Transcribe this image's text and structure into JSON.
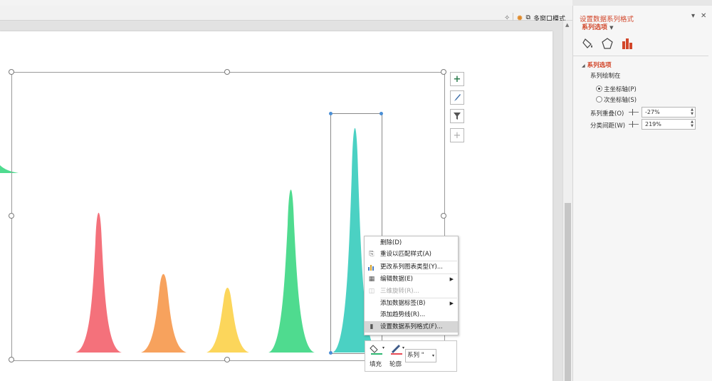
{
  "toolbar": {
    "multi_window_label": "多窗口模式"
  },
  "chart": {
    "colors": {
      "red": "#f4717b",
      "orange": "#f7a25d",
      "yellow": "#fcd65b",
      "green": "#4fdb8f",
      "teal": "#4bd1c3"
    },
    "buttons": [
      "add-element",
      "chart-style",
      "chart-filter",
      "crosshair"
    ]
  },
  "context_menu": {
    "items": [
      {
        "label": "删除(D)",
        "icon": "delete-icon",
        "enabled": true
      },
      {
        "label": "重设以匹配样式(A)",
        "icon": "reset-style-icon",
        "enabled": true
      },
      {
        "label": "更改系列图表类型(Y)...",
        "icon": "bar-chart-icon",
        "enabled": true
      },
      {
        "label": "编辑数据(E)",
        "icon": "edit-data-icon",
        "enabled": true,
        "submenu": true
      },
      {
        "label": "三维旋转(R)...",
        "icon": "rotate-3d-icon",
        "enabled": false
      },
      {
        "label": "添加数据标签(B)",
        "icon": "",
        "enabled": true,
        "submenu": true
      },
      {
        "label": "添加趋势线(R)...",
        "icon": "",
        "enabled": true
      },
      {
        "label": "设置数据系列格式(F)...",
        "icon": "format-series-icon",
        "enabled": true,
        "active": true
      }
    ]
  },
  "mini_toolbar": {
    "fill_label": "填充",
    "outline_label": "轮廓",
    "series_value": "系列 \""
  },
  "panel": {
    "title": "设置数据系列格式",
    "subtitle": "系列选项",
    "section": "系列选项",
    "plot_on_label": "系列绘制在",
    "primary_axis_label": "主坐标轴(P)",
    "secondary_axis_label": "次坐标轴(S)",
    "selected_axis": "primary",
    "overlap_label": "系列重叠(O)",
    "overlap_value": "-27%",
    "gap_label": "分类间距(W)",
    "gap_value": "219%"
  }
}
